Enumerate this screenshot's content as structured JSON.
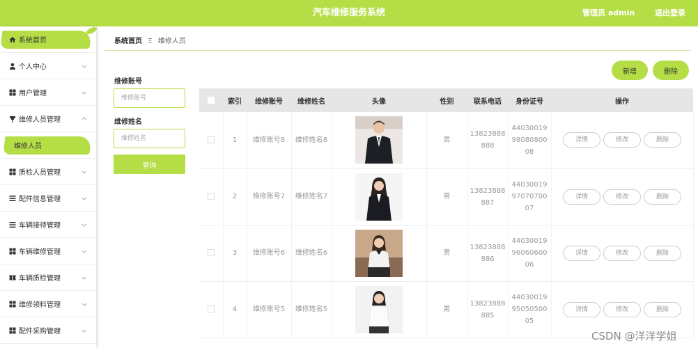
{
  "header": {
    "title": "汽车维修服务系统",
    "admin": "管理员 admin",
    "logout": "退出登录",
    "accent": "#b5de46"
  },
  "sidebar": {
    "items": [
      {
        "label": "系统首页",
        "icon": "home-icon"
      },
      {
        "label": "个人中心",
        "icon": "person-icon"
      },
      {
        "label": "用户管理",
        "icon": "grid-icon"
      },
      {
        "label": "维修人员管理",
        "icon": "pin-icon"
      },
      {
        "label": "维修人员"
      },
      {
        "label": "质检人员管理",
        "icon": "grid-icon"
      },
      {
        "label": "配件信息管理",
        "icon": "list-icon"
      },
      {
        "label": "车辆接待管理",
        "icon": "list-icon"
      },
      {
        "label": "车辆维修管理",
        "icon": "grid-icon"
      },
      {
        "label": "车辆质检管理",
        "icon": "ticket-icon"
      },
      {
        "label": "维修领料管理",
        "icon": "grid-icon"
      },
      {
        "label": "配件采购管理",
        "icon": "grid-icon"
      }
    ]
  },
  "breadcrumb": {
    "home": "系统首页",
    "separator": "Ξ",
    "current": "维修人员"
  },
  "search": {
    "account_label": "维修账号",
    "account_placeholder": "维修账号",
    "name_label": "维修姓名",
    "name_placeholder": "维修姓名",
    "button": "查询"
  },
  "actions": {
    "add": "新增",
    "delete": "删除"
  },
  "table": {
    "headers": [
      "",
      "索引",
      "维修账号",
      "维修姓名",
      "头像",
      "性别",
      "联系电话",
      "身份证号",
      "操作"
    ],
    "row_buttons": {
      "detail": "详情",
      "edit": "修改",
      "delete": "删除"
    },
    "rows": [
      {
        "index": "1",
        "account": "维修账号8",
        "name": "维修姓名8",
        "gender": "男",
        "phone": [
          "13823888",
          "888"
        ],
        "id_card": [
          "44030019",
          "98080800",
          "08"
        ]
      },
      {
        "index": "2",
        "account": "维修账号7",
        "name": "维修姓名7",
        "gender": "男",
        "phone": [
          "13823888",
          "887"
        ],
        "id_card": [
          "44030019",
          "97070700",
          "07"
        ]
      },
      {
        "index": "3",
        "account": "维修账号6",
        "name": "维修姓名6",
        "gender": "男",
        "phone": [
          "13823888",
          "886"
        ],
        "id_card": [
          "44030019",
          "96060600",
          "06"
        ]
      },
      {
        "index": "4",
        "account": "维修账号5",
        "name": "维修姓名5",
        "gender": "男",
        "phone": [
          "13823888",
          "885"
        ],
        "id_card": [
          "44030019",
          "95050500",
          "05"
        ]
      }
    ]
  },
  "watermark": "CSDN @洋洋学姐"
}
